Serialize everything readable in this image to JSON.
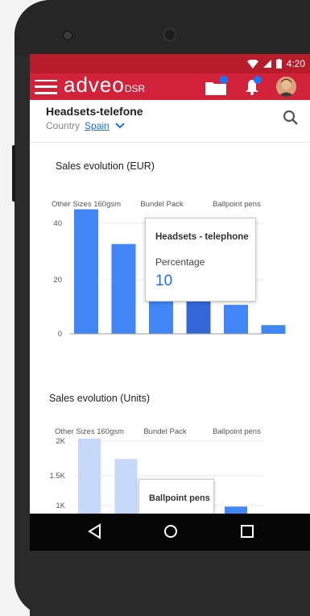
{
  "status": {
    "time": "4:20"
  },
  "app": {
    "logo": "adveo",
    "logo_suffix": "DSR"
  },
  "page": {
    "title": "Headsets-telefone",
    "country_label": "Country",
    "country_value": "Spain"
  },
  "chart1": {
    "section_title": "Sales evolution (EUR)",
    "tooltip_title": "Headsets - telephone",
    "tooltip_label": "Percentage",
    "tooltip_value": "10"
  },
  "chart2": {
    "section_title": "Sales evolution (Units)",
    "tooltip_title": "Ballpoint pens"
  },
  "colors": {
    "accent": "#d2223a",
    "bar": "#4285f4",
    "bar_dark": "#3367d6",
    "bar_light": "#c6d9f8",
    "notify": "#1976ff"
  },
  "chart_data": [
    {
      "type": "bar",
      "title": "Sales evolution (EUR)",
      "categories": [
        "Other Sizes 160gsm",
        "Bundel Pack",
        "Ballpoint pens"
      ],
      "values": [
        43,
        31,
        22,
        12,
        10,
        3
      ],
      "y_ticks": [
        "40",
        "20",
        "0"
      ],
      "ylim": [
        0,
        44
      ]
    },
    {
      "type": "bar",
      "title": "Sales evolution (Units)",
      "categories": [
        "Other Sizes 160gsm",
        "Bundel Pack",
        "Ballpoint pens"
      ],
      "values": [
        2000,
        1730,
        1400,
        1200,
        1100
      ],
      "y_ticks": [
        "2K",
        "1.5K",
        "1K"
      ],
      "ylim": [
        900,
        2000
      ]
    }
  ]
}
